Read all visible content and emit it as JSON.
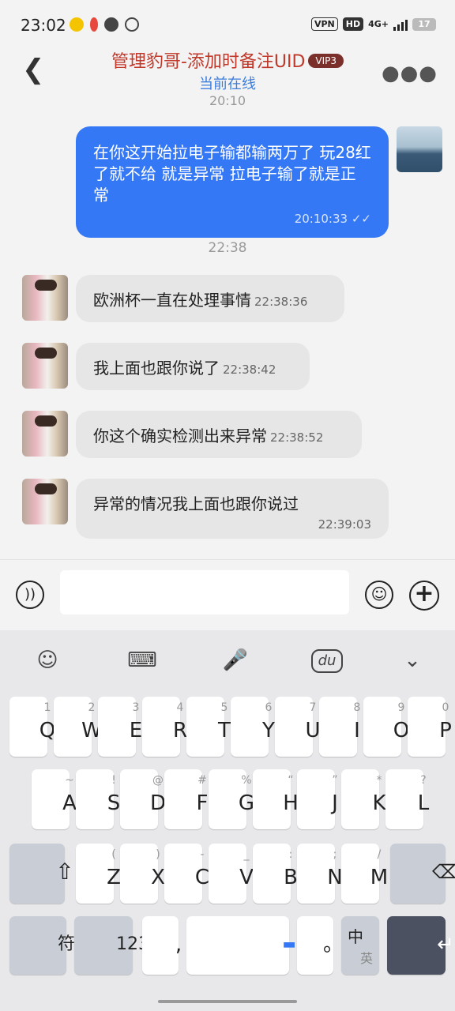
{
  "status_bar": {
    "time": "23:02",
    "vpn": "VPN",
    "hd": "HD",
    "network": "4G+",
    "battery": "17"
  },
  "header": {
    "title": "管理豹哥-添加时备注UID",
    "vip": "VIP3",
    "subtitle": "当前在线"
  },
  "chat": {
    "timestamp_top": "20:10",
    "my_message": {
      "text": "在你这开始拉电子输都输两万了 玩28红了就不给 就是异常 拉电子输了就是正常",
      "time": "20:10:33",
      "status": "✓✓"
    },
    "timestamp_mid": "22:38",
    "messages": [
      {
        "text": "欧洲杯一直在处理事情",
        "time": "22:38:36"
      },
      {
        "text": "我上面也跟你说了",
        "time": "22:38:42"
      },
      {
        "text": "你这个确实检测出来异常",
        "time": "22:38:52"
      },
      {
        "text": "异常的情况我上面也跟你说过",
        "time": "22:39:03"
      }
    ]
  },
  "input": {
    "placeholder": ""
  },
  "keyboard": {
    "row1": [
      {
        "sub": "1",
        "main": "Q"
      },
      {
        "sub": "2",
        "main": "W"
      },
      {
        "sub": "3",
        "main": "E"
      },
      {
        "sub": "4",
        "main": "R"
      },
      {
        "sub": "5",
        "main": "T"
      },
      {
        "sub": "6",
        "main": "Y"
      },
      {
        "sub": "7",
        "main": "U"
      },
      {
        "sub": "8",
        "main": "I"
      },
      {
        "sub": "9",
        "main": "O"
      },
      {
        "sub": "0",
        "main": "P"
      }
    ],
    "row2": [
      {
        "sub": "~",
        "main": "A"
      },
      {
        "sub": "!",
        "main": "S"
      },
      {
        "sub": "@",
        "main": "D"
      },
      {
        "sub": "#",
        "main": "F"
      },
      {
        "sub": "%",
        "main": "G"
      },
      {
        "sub": "“",
        "main": "H"
      },
      {
        "sub": "”",
        "main": "J"
      },
      {
        "sub": "*",
        "main": "K"
      },
      {
        "sub": "?",
        "main": "L"
      }
    ],
    "row3": [
      {
        "sub": "(",
        "main": "Z"
      },
      {
        "sub": ")",
        "main": "X"
      },
      {
        "sub": "-",
        "main": "C"
      },
      {
        "sub": "_",
        "main": "V"
      },
      {
        "sub": ":",
        "main": "B"
      },
      {
        "sub": ";",
        "main": "N"
      },
      {
        "sub": "/",
        "main": "M"
      }
    ],
    "symbols_key": "符",
    "numbers_key": "123",
    "comma_key": ",",
    "period_key": "。",
    "lang_key_top": "中",
    "lang_key_bottom": "英",
    "toolbar_du": "du"
  },
  "colors": {
    "accent": "#3578f6",
    "title_red": "#c0392b",
    "subtitle_blue": "#3b7ddd",
    "vip_bg": "#7a2f2a"
  },
  "icons": [
    "back-icon",
    "more-icon",
    "voice-icon",
    "emoji-icon",
    "plus-icon",
    "keyboard-emoji-icon",
    "keyboard-layout-icon",
    "microphone-icon",
    "du-icon",
    "collapse-icon",
    "shift-icon",
    "backspace-icon",
    "enter-icon"
  ]
}
